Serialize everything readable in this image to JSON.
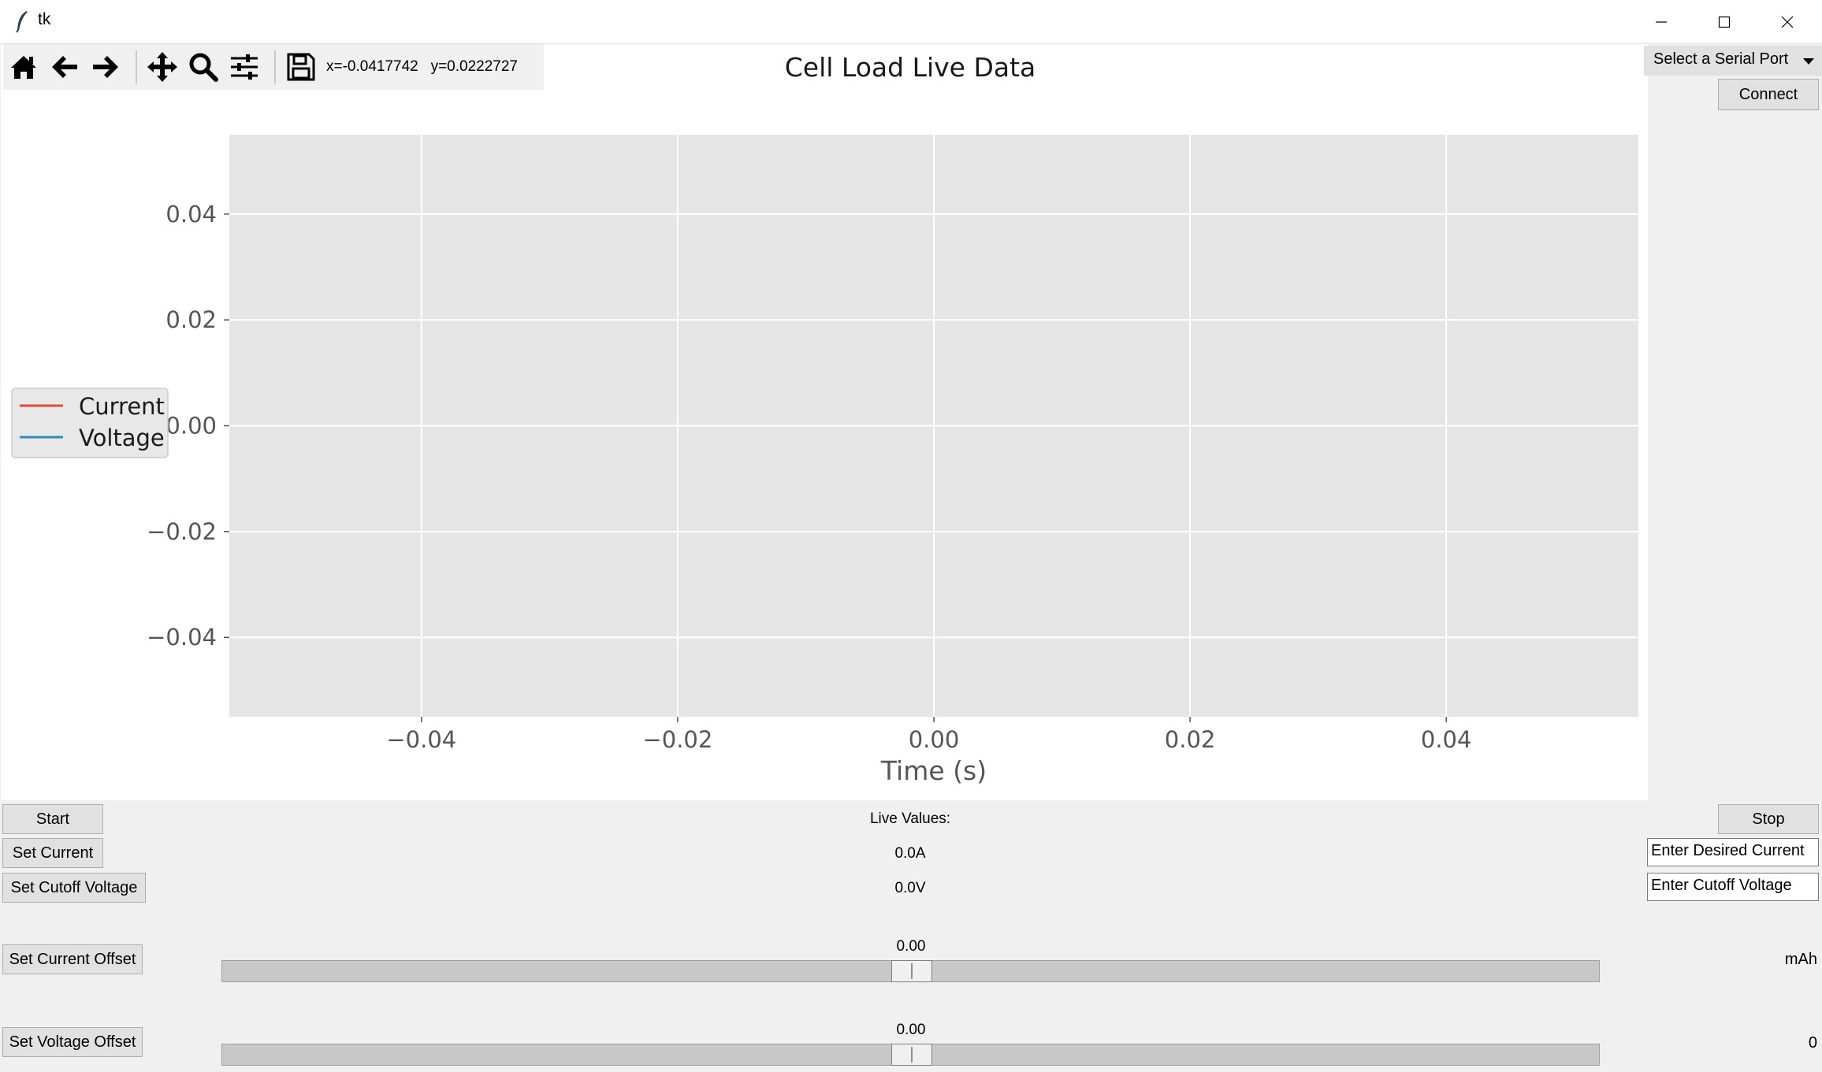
{
  "window": {
    "title": "tk"
  },
  "toolbar": {
    "buttons": [
      {
        "name": "home-button",
        "icon": "home-icon"
      },
      {
        "name": "back-button",
        "icon": "arrow-left-icon"
      },
      {
        "name": "forward-button",
        "icon": "arrow-right-icon"
      },
      {
        "name": "pan-button",
        "icon": "move-icon"
      },
      {
        "name": "zoom-button",
        "icon": "magnifier-icon"
      },
      {
        "name": "configure-subplots-button",
        "icon": "sliders-icon"
      },
      {
        "name": "save-figure-button",
        "icon": "floppy-disk-icon"
      }
    ],
    "coordinates": "x=-0.0417742   y=0.0222727"
  },
  "serial": {
    "select_label": "Select a Serial Port",
    "connect_label": "Connect"
  },
  "chart_data": {
    "type": "line",
    "title": "Cell Load Live Data",
    "xlabel": "Time (s)",
    "ylabel": "",
    "xlim": [
      -0.055,
      0.055
    ],
    "ylim": [
      -0.055,
      0.055
    ],
    "xticks": [
      -0.04,
      -0.02,
      0.0,
      0.02,
      0.04
    ],
    "xtick_labels": [
      "−0.04",
      "−0.02",
      "0.00",
      "0.02",
      "0.04"
    ],
    "yticks": [
      0.04,
      0.02,
      0.0,
      -0.02,
      -0.04
    ],
    "ytick_labels": [
      "0.04",
      "0.02",
      "0.00",
      "−0.02",
      "−0.04"
    ],
    "grid": true,
    "legend_position": "center-left",
    "series": [
      {
        "name": "Current",
        "color": "#e24a33",
        "x": [],
        "y": []
      },
      {
        "name": "Voltage",
        "color": "#348abd",
        "x": [],
        "y": []
      }
    ],
    "plot_background": "#e5e5e5"
  },
  "controls": {
    "start_label": "Start",
    "stop_label": "Stop",
    "set_current_label": "Set Current",
    "set_cutoff_voltage_label": "Set Cutoff Voltage",
    "set_current_offset_label": "Set Current Offset",
    "set_voltage_offset_label": "Set Voltage Offset",
    "live_values_label": "Live Values:",
    "live_current": "0.0A",
    "live_voltage": "0.0V",
    "current_entry_value": "Enter Desired Current",
    "cutoff_entry_value": "Enter Cutoff Voltage",
    "current_offset_value": "0.00",
    "voltage_offset_value": "0.00",
    "current_offset_fraction": 0.5,
    "voltage_offset_fraction": 0.5,
    "capacity_label": "mAh",
    "bottom_right_value": "0"
  }
}
